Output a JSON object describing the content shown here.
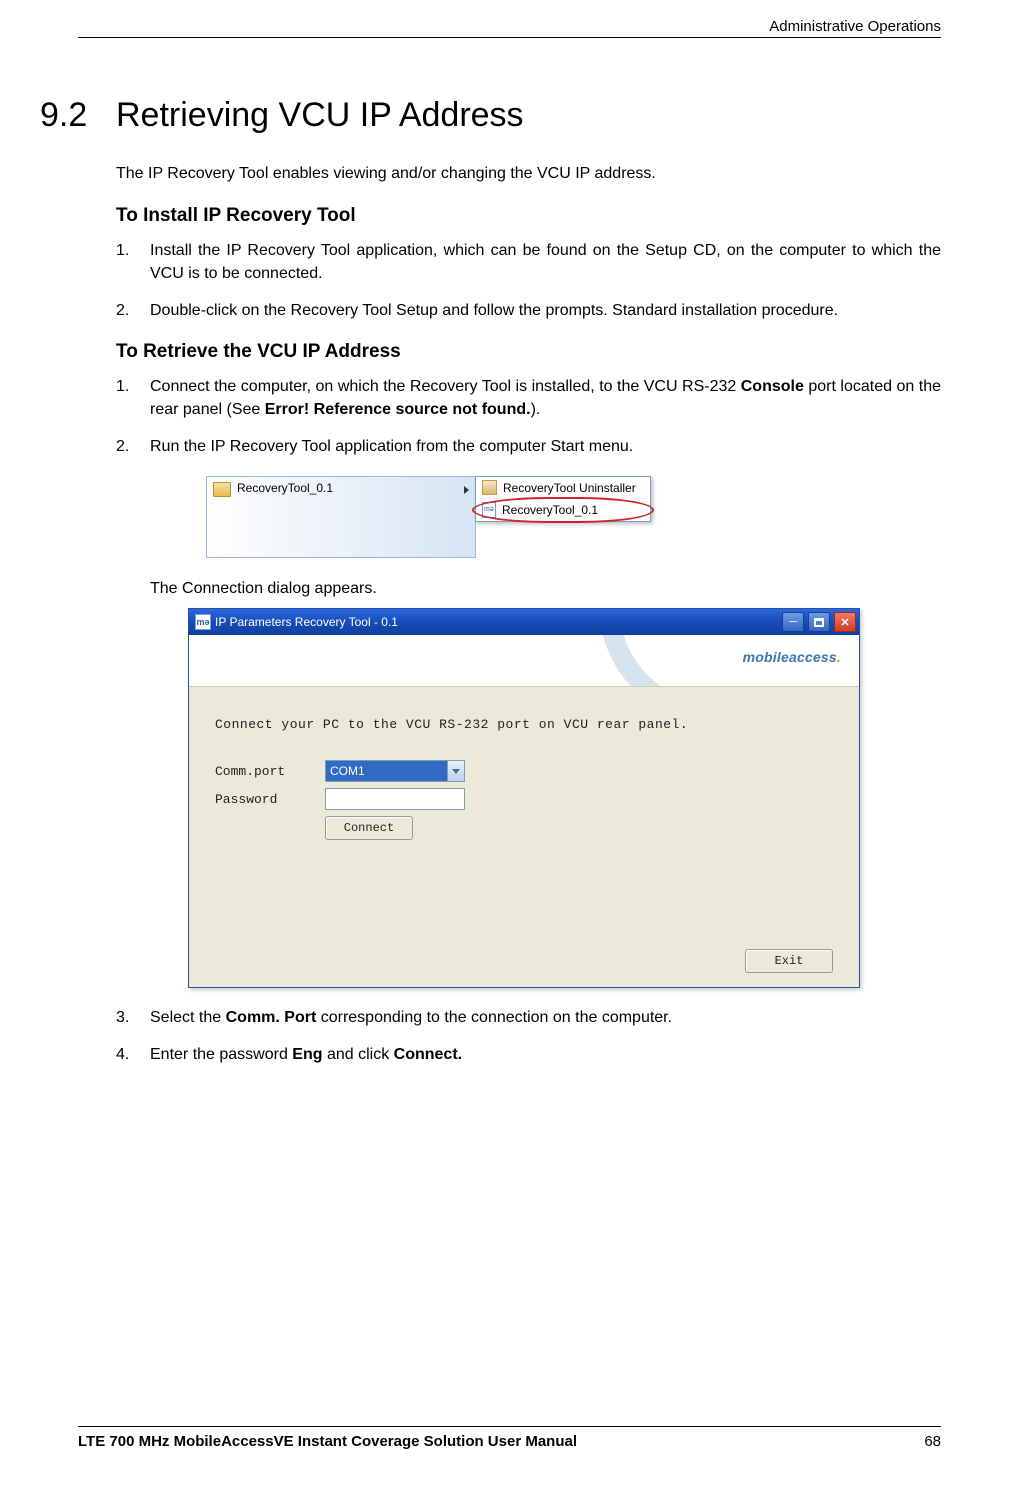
{
  "header": {
    "right": "Administrative Operations"
  },
  "section": {
    "number": "9.2",
    "title": "Retrieving VCU IP Address"
  },
  "intro": "The IP Recovery Tool enables viewing and/or changing the VCU IP address.",
  "install": {
    "heading": "To Install IP Recovery Tool",
    "step1": "Install the IP Recovery Tool application, which can be found on the Setup CD, on the computer to which the VCU is to be connected.",
    "step2": "Double-click on the Recovery Tool Setup and follow the prompts. Standard installation procedure."
  },
  "retrieve": {
    "heading": "To Retrieve the VCU IP Address",
    "step1_pre": "Connect the computer, on which the Recovery Tool is installed, to the VCU RS-232 ",
    "step1_bold1": "Console",
    "step1_mid1": " port located on the rear panel (See ",
    "step1_bold2": "Error! Reference source not found.",
    "step1_mid2": ").",
    "step2": "Run the IP Recovery Tool application from the computer Start menu.",
    "flyout_left": "RecoveryTool_0.1",
    "flyout_item1": "RecoveryTool Uninstaller",
    "flyout_item2": "RecoveryTool_0.1",
    "caption": "The Connection dialog appears.",
    "step3_pre": "Select the ",
    "step3_bold": "Comm. Port",
    "step3_post": " corresponding to the connection on the computer.",
    "step4_pre": "Enter the password ",
    "step4_bold1": "Eng",
    "step4_mid": " and click ",
    "step4_bold2": "Connect."
  },
  "dialog": {
    "title": "IP Parameters Recovery Tool - 0.1",
    "logo_brand": "mobile",
    "logo_brand2": "access",
    "instruction": "Connect your PC to the VCU RS-232 port on VCU rear panel.",
    "label_comm": "Comm.port",
    "label_pass": "Password",
    "combo_value": "COM1",
    "btn_connect": "Connect",
    "btn_exit": "Exit"
  },
  "footer": {
    "left": "LTE 700 MHz MobileAccessVE Instant Coverage Solution User Manual",
    "page": "68"
  }
}
